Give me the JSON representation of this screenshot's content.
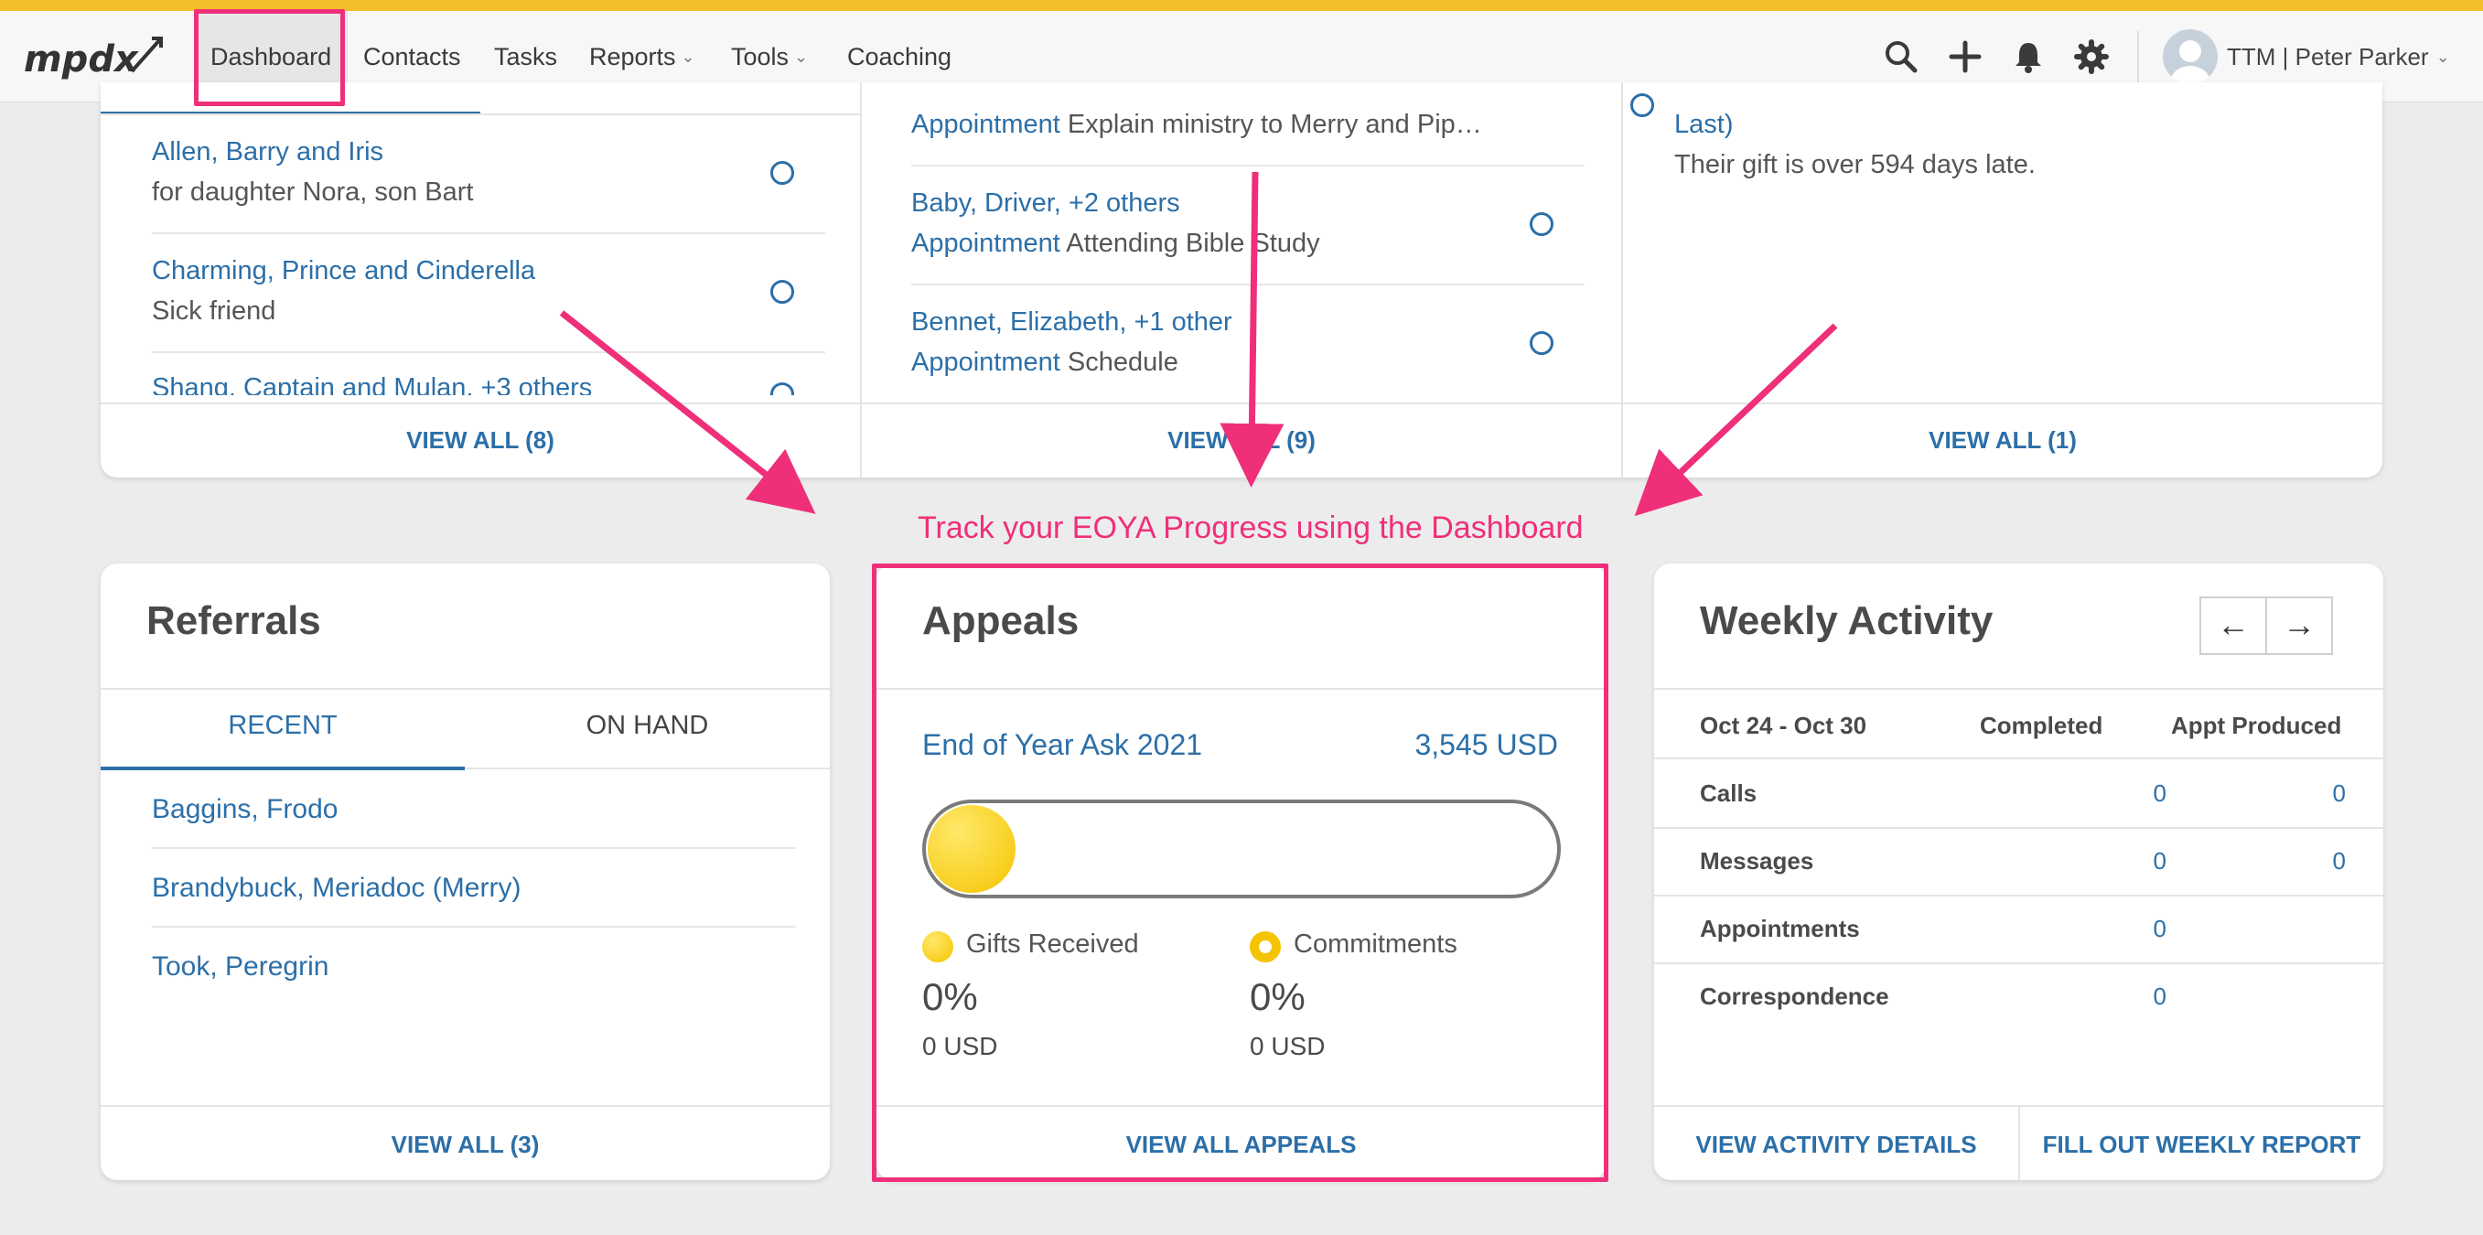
{
  "nav": {
    "items": [
      {
        "label": "Dashboard",
        "dropdown": false,
        "active": true
      },
      {
        "label": "Contacts",
        "dropdown": false
      },
      {
        "label": "Tasks",
        "dropdown": false
      },
      {
        "label": "Reports",
        "dropdown": true
      },
      {
        "label": "Tools",
        "dropdown": true
      },
      {
        "label": "Coaching",
        "dropdown": false
      }
    ],
    "icons": [
      "search-icon",
      "plus-icon",
      "bell-icon",
      "gear-icon"
    ],
    "user_label": "TTM | Peter Parker",
    "brand": "mpdx",
    "accent_color": "#f4bd2a"
  },
  "top_cards": [
    {
      "items": [
        {
          "name": "Allen, Barry and Iris",
          "desc": "for daughter Nora, son Bart"
        },
        {
          "name": "Charming, Prince and Cinderella",
          "desc": "Sick friend"
        },
        {
          "name": "Shang, Captain and Mulan, +3 others",
          "desc": ""
        }
      ],
      "footer": "VIEW ALL (8)"
    },
    {
      "items": [
        {
          "name": "",
          "type": "Appointment",
          "desc": "Explain ministry to Merry and Pip…"
        },
        {
          "name": "Baby, Driver, +2 others",
          "type": "Appointment",
          "desc": "Attending Bible Study"
        },
        {
          "name": "Bennet, Elizabeth, +1 other",
          "type": "Appointment",
          "desc": "Schedule"
        }
      ],
      "footer": "VIEW ALL (9)"
    },
    {
      "items": [
        {
          "name": "Last)",
          "desc": "Their gift is over 594 days late."
        }
      ],
      "footer": "VIEW ALL (1)"
    }
  ],
  "annotation": {
    "text": "Track your EOYA Progress using the Dashboard",
    "color": "#ef2f7a"
  },
  "referrals": {
    "title": "Referrals",
    "tabs": [
      {
        "label": "RECENT",
        "active": true
      },
      {
        "label": "ON HAND",
        "active": false
      }
    ],
    "items": [
      "Baggins, Frodo",
      "Brandybuck, Meriadoc (Merry)",
      "Took, Peregrin"
    ],
    "footer": "VIEW ALL (3)"
  },
  "appeals": {
    "title": "Appeals",
    "appeal_name": "End of Year Ask 2021",
    "goal": "3,545 USD",
    "progress_received": 0,
    "progress_committed": 0,
    "gifts": {
      "label": "Gifts Received",
      "percent": "0%",
      "amount": "0 USD"
    },
    "commitments": {
      "label": "Commitments",
      "percent": "0%",
      "amount": "0 USD"
    },
    "footer": "VIEW ALL APPEALS"
  },
  "weekly": {
    "title": "Weekly Activity",
    "range": "Oct 24 - Oct 30",
    "col_completed": "Completed",
    "col_appt": "Appt Produced",
    "rows": [
      {
        "label": "Calls",
        "completed": "0",
        "appt": "0"
      },
      {
        "label": "Messages",
        "completed": "0",
        "appt": "0"
      },
      {
        "label": "Appointments",
        "completed": "0",
        "appt": ""
      },
      {
        "label": "Correspondence",
        "completed": "0",
        "appt": ""
      }
    ],
    "footer_left": "VIEW ACTIVITY DETAILS",
    "footer_right": "FILL OUT WEEKLY REPORT"
  }
}
